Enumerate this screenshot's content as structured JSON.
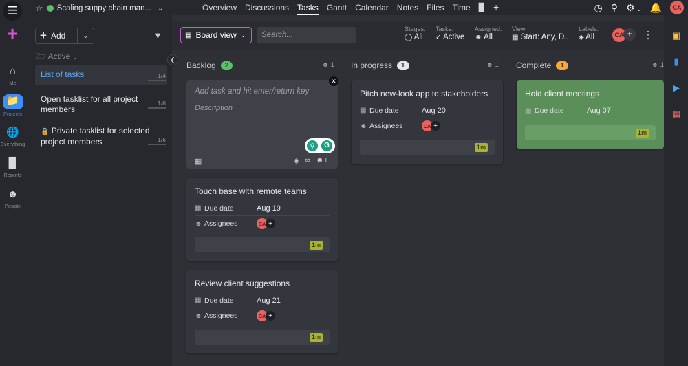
{
  "rail": {
    "items": [
      {
        "label": "Me",
        "icon": "home-icon"
      },
      {
        "label": "Projects",
        "icon": "folder-icon"
      },
      {
        "label": "Everything",
        "icon": "globe-icon"
      },
      {
        "label": "Reports",
        "icon": "bar-chart-icon"
      },
      {
        "label": "People",
        "icon": "people-icon"
      }
    ]
  },
  "topbar": {
    "project_name": "Scaling suppy chain man...",
    "status_color": "#5cbf6a",
    "tabs": [
      "Overview",
      "Discussions",
      "Tasks",
      "Gantt",
      "Calendar",
      "Notes",
      "Files",
      "Time"
    ],
    "active_tab": "Tasks",
    "user_initials": "CA"
  },
  "sidebar": {
    "add_label": "Add",
    "active_header": "Active",
    "tasklists": [
      {
        "name": "List of tasks",
        "count": "1/4"
      },
      {
        "name": "Open tasklist for all project members",
        "count": "1/8"
      },
      {
        "name": "Private tasklist for selected project members",
        "count": "1/6"
      }
    ]
  },
  "toolbar": {
    "view_label": "Board view",
    "search_placeholder": "Search...",
    "filters": [
      {
        "title": "Stages:",
        "value": "All"
      },
      {
        "title": "Tasks:",
        "value": "Active"
      },
      {
        "title": "Assigned:",
        "value": "All"
      },
      {
        "title": "View:",
        "value": "Start: Any, D..."
      },
      {
        "title": "Labels:",
        "value": "All"
      }
    ],
    "avatar": "CA"
  },
  "columns": [
    {
      "name": "Backlog",
      "count": "2",
      "users": "1",
      "badge_color": "#5cbf6a"
    },
    {
      "name": "In progress",
      "count": "1",
      "users": "1",
      "badge_color": "#e6e7ea"
    },
    {
      "name": "Complete",
      "count": "1",
      "users": "1",
      "badge_color": "#f6a93b"
    }
  ],
  "new_task": {
    "title_placeholder": "Add task and hit enter/return key",
    "description_placeholder": "Description"
  },
  "cards": {
    "backlog_1": {
      "title": "Touch base with remote teams",
      "due_label": "Due date",
      "due": "Aug 19",
      "assignees_label": "Assignees",
      "assignee": "CA",
      "estimate": "1m"
    },
    "backlog_2": {
      "title": "Review client suggestions",
      "due_label": "Due date",
      "due": "Aug 21",
      "assignees_label": "Assignees",
      "assignee": "CA",
      "estimate": "1m"
    },
    "progress_1": {
      "title": "Pitch new-look app to stakeholders",
      "due_label": "Due date",
      "due": "Aug 20",
      "assignees_label": "Assignees",
      "assignee": "CA",
      "estimate": "1m"
    },
    "complete_1": {
      "title": "Hold client meetings",
      "due_label": "Due date",
      "due": "Aug 07",
      "estimate": "1m"
    }
  }
}
